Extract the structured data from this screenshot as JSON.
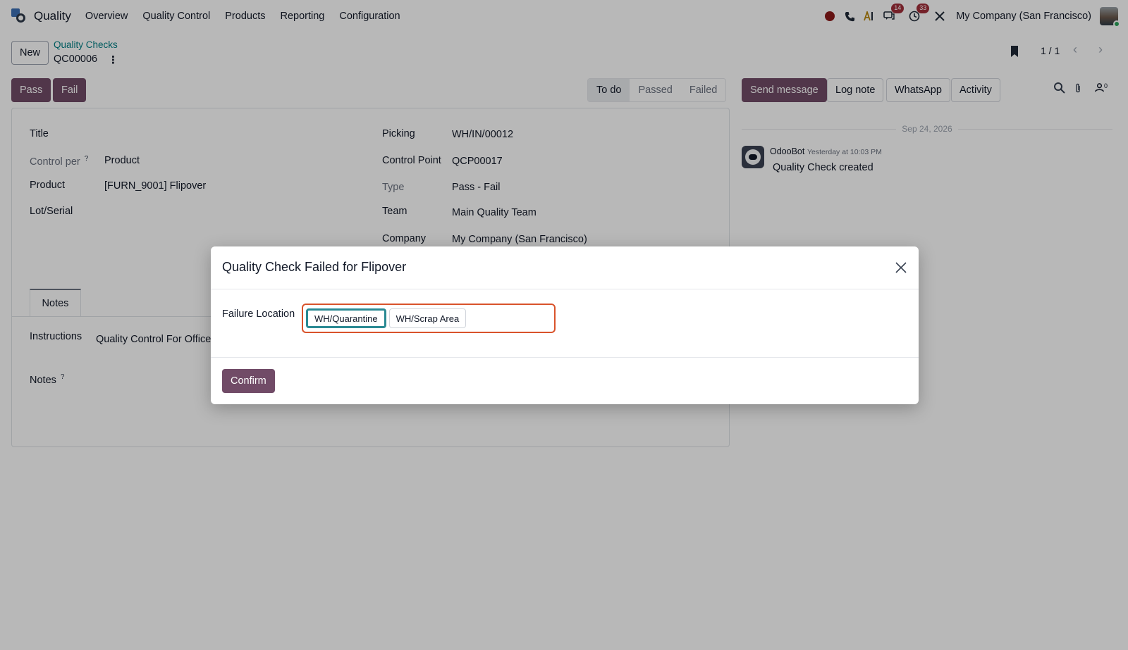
{
  "navbar": {
    "app_name": "Quality",
    "menu": [
      "Overview",
      "Quality Control",
      "Products",
      "Reporting",
      "Configuration"
    ],
    "messages_badge": "14",
    "activities_badge": "33",
    "company": "My Company (San Francisco)"
  },
  "control_panel": {
    "new_label": "New",
    "breadcrumb_parent": "Quality Checks",
    "record_name": "QC00006",
    "pager": "1 / 1"
  },
  "actions": {
    "pass_label": "Pass",
    "fail_label": "Fail"
  },
  "status": {
    "steps": [
      "To do",
      "Passed",
      "Failed"
    ],
    "active": "To do"
  },
  "form": {
    "title_label": "Title",
    "control_per_label": "Control per",
    "control_per_value": "Product",
    "product_label": "Product",
    "product_value": "[FURN_9001] Flipover",
    "lot_label": "Lot/Serial",
    "picking_label": "Picking",
    "picking_value": "WH/IN/00012",
    "control_point_label": "Control Point",
    "control_point_value": "QCP00017",
    "type_label": "Type",
    "type_value": "Pass - Fail",
    "team_label": "Team",
    "team_value": "Main Quality Team",
    "company_label": "Company",
    "company_value": "My Company (San Francisco)",
    "tab_notes": "Notes",
    "instructions_label": "Instructions",
    "instructions_value": "Quality Control For Office",
    "notes_label": "Notes",
    "help_mark": "?"
  },
  "chatter": {
    "send_message": "Send message",
    "log_note": "Log note",
    "whatsapp": "WhatsApp",
    "activity": "Activity",
    "followers_count": "0",
    "date_separator": "Sep 24, 2026",
    "message": {
      "author": "OdooBot",
      "time": "Yesterday at 10:03 PM",
      "body": "Quality Check created"
    }
  },
  "modal": {
    "title": "Quality Check Failed for Flipover",
    "field_label": "Failure Location",
    "options": [
      "WH/Quarantine",
      "WH/Scrap Area"
    ],
    "selected": "WH/Quarantine",
    "confirm_label": "Confirm"
  },
  "colors": {
    "primary": "#714b67",
    "link": "#017e84",
    "highlight_border": "#d9532b",
    "selected_tag": "#2a8a93"
  }
}
